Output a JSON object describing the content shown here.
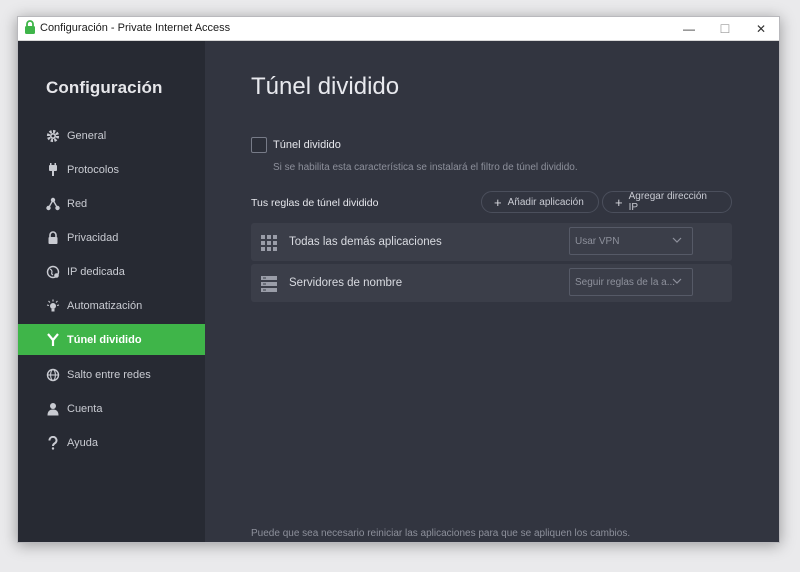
{
  "window": {
    "title": "Configuración - Private Internet Access",
    "minimize": "—",
    "maximize": "☐",
    "close": "✕"
  },
  "sidebar": {
    "heading": "Configuración",
    "items": [
      {
        "label": "General",
        "icon": "gear-icon"
      },
      {
        "label": "Protocolos",
        "icon": "plug-icon"
      },
      {
        "label": "Red",
        "icon": "network-icon"
      },
      {
        "label": "Privacidad",
        "icon": "lock-icon"
      },
      {
        "label": "IP dedicada",
        "icon": "globe-icon"
      },
      {
        "label": "Automatización",
        "icon": "lightbulb-icon"
      },
      {
        "label": "Túnel dividido",
        "icon": "split-icon",
        "active": true
      },
      {
        "label": "Salto entre redes",
        "icon": "globe-network-icon"
      },
      {
        "label": "Cuenta",
        "icon": "user-icon"
      },
      {
        "label": "Ayuda",
        "icon": "question-icon"
      }
    ]
  },
  "main": {
    "title": "Túnel dividido",
    "checkbox_label": "Túnel dividido",
    "checkbox_checked": false,
    "checkbox_desc": "Si se habilita esta característica se instalará el filtro de túnel dividido.",
    "rules_label": "Tus reglas de túnel dividido",
    "add_app": "Añadir aplicación",
    "add_ip": "Agregar dirección IP",
    "rules": [
      {
        "name": "Todas las demás aplicaciones",
        "select": "Usar VPN",
        "icon": "grid-icon"
      },
      {
        "name": "Servidores de nombre",
        "select": "Seguir reglas de la a...",
        "icon": "server-icon"
      }
    ],
    "footer": "Puede que sea necesario reiniciar las aplicaciones para que se apliquen los cambios."
  },
  "colors": {
    "accent": "#3fb549",
    "sidebar_bg": "#272a33",
    "main_bg": "#323540"
  }
}
